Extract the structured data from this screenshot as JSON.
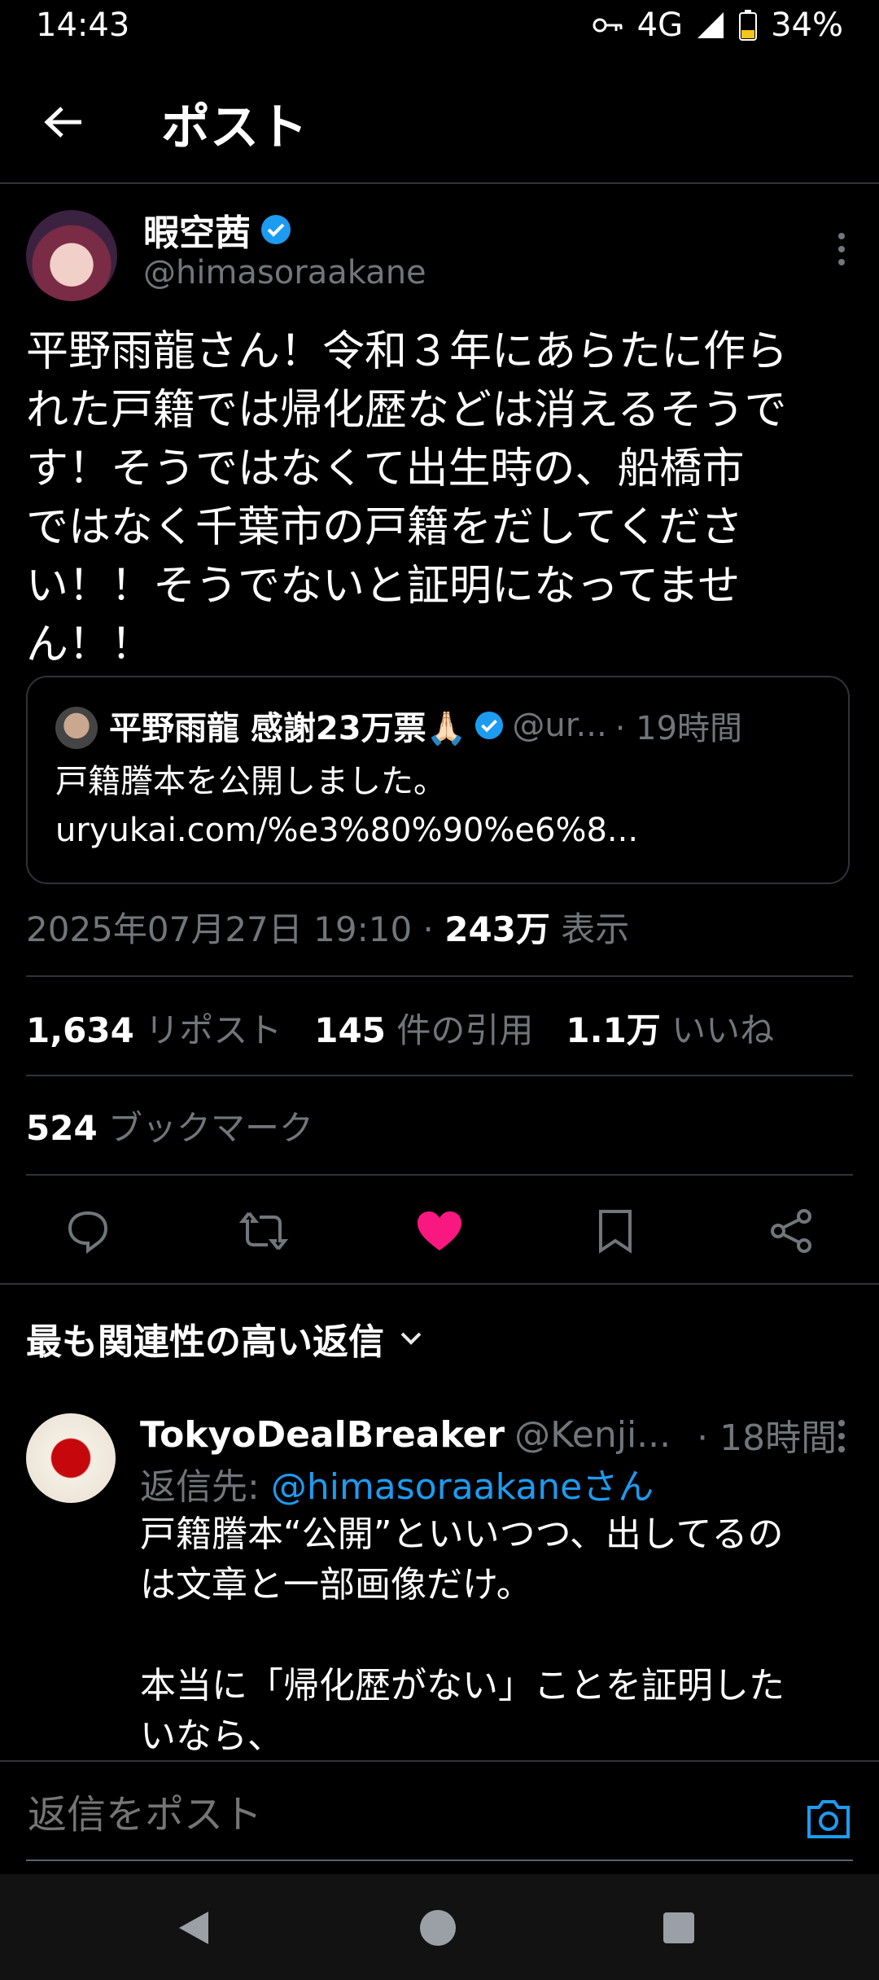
{
  "status": {
    "time": "14:43",
    "network": "4G",
    "battery": "34%"
  },
  "header": {
    "title": "ポスト"
  },
  "post": {
    "author_name": "暇空茜",
    "author_handle": "@himasoraakane",
    "text": "平野雨龍さん！令和３年にあらたに作ら\nれた戸籍では帰化歴などは消えるそうで\nす！そうではなくて出生時の、船橋市\nではなく千葉市の戸籍をだしてくださ\nい！！そうでないと証明になってませ\nん！！",
    "quote": {
      "author_name": "平野雨龍 感謝23万票🙏🏻",
      "handle": "@ur...",
      "time": "· 19時間",
      "text": "戸籍謄本を公開しました。",
      "link": "uryukai.com/%e3%80%90%e6%8..."
    },
    "timestamp": "2025年07月27日 19:10 ·",
    "views_count": "243万",
    "views_label": "表示",
    "reposts_count": "1,634",
    "reposts_label": "リポスト",
    "quotes_count": "145",
    "quotes_label": "件の引用",
    "likes_count": "1.1万",
    "likes_label": "いいね",
    "bookmarks_count": "524",
    "bookmarks_label": "ブックマーク"
  },
  "replies_sort": {
    "label": "最も関連性の高い返信"
  },
  "reply": {
    "author_name": "TokyoDealBreaker",
    "handle": "@Kenji...",
    "time": "· 18時間",
    "reply_to_prefix": "返信先:",
    "reply_to_handle": "@himasoraakaneさん",
    "text": "戸籍謄本“公開”といいつつ、出してるの\nは文章と一部画像だけ。\n\n本当に「帰化歴がない」ことを証明した\nいなら、"
  },
  "compose": {
    "placeholder": "返信をポスト"
  },
  "colors": {
    "accent": "#1d9bf0",
    "like": "#f91880",
    "muted": "#71767b",
    "background": "#000000"
  },
  "icons": [
    "back-arrow-icon",
    "key-icon",
    "signal-icon",
    "battery-icon",
    "verified-icon",
    "more-icon",
    "reply-icon",
    "repost-icon",
    "like-icon",
    "bookmark-icon",
    "share-icon",
    "chevron-down-icon",
    "camera-icon",
    "nav-back-icon",
    "nav-home-icon",
    "nav-recents-icon"
  ]
}
